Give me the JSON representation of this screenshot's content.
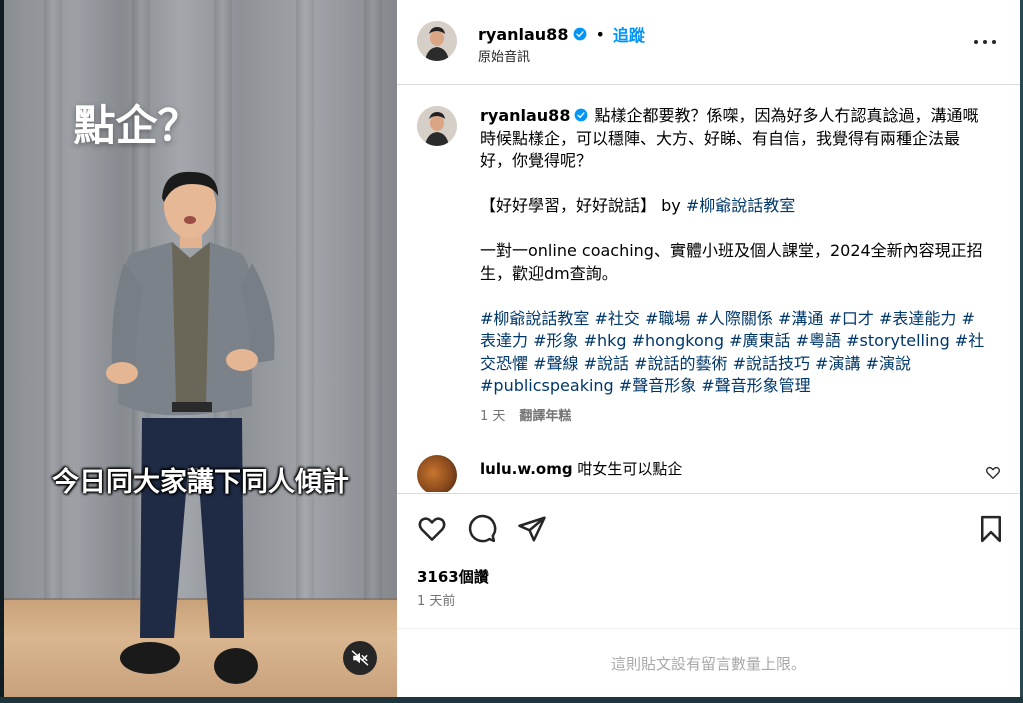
{
  "video": {
    "title": "點企？",
    "caption": "今日同大家講下同人傾計",
    "mute_icon": "speaker-muted-icon"
  },
  "header": {
    "username": "ryanlau88",
    "separator": "•",
    "follow_label": "追蹤",
    "audio_label": "原始音訊",
    "more_icon": "more-horizontal-icon"
  },
  "caption": {
    "username": "ryanlau88",
    "line1": "點樣企都要教？係㗎，因為好多人冇認真諗過，溝通嘅時候點樣企，可以穩陣、大方、好睇、有自信，我覺得有兩種企法最好，你覺得呢？",
    "line2_text": "【好好學習，好好說話】 by ",
    "line2_tag": "#柳爺說話教室",
    "line3": "一對一online coaching、實體小班及個人課堂，2024全新內容現正招生，歡迎dm查詢。",
    "hashtags": "#柳爺說話教室 #社交 #職場 #人際關係 #溝通 #口才 #表達能力 #表達力 #形象 #hkg #hongkong #廣東話 #粵語 #storytelling #社交恐懼 #聲線 #說話 #說話的藝術 #說話技巧 #演講 #演說 #publicspeaking #聲音形象 #聲音形象管理",
    "age": "1 天",
    "translate_label": "翻譯年糕"
  },
  "comment": {
    "username": "lulu.w.omg",
    "text": "咁女生可以點企"
  },
  "actions": {
    "views": "3163個讚",
    "time": "1 天前"
  },
  "footer": {
    "text": "這則貼文設有留言數量上限。"
  },
  "colors": {
    "link": "#0095f6",
    "hashtag": "#00376b",
    "muted": "#737373"
  }
}
